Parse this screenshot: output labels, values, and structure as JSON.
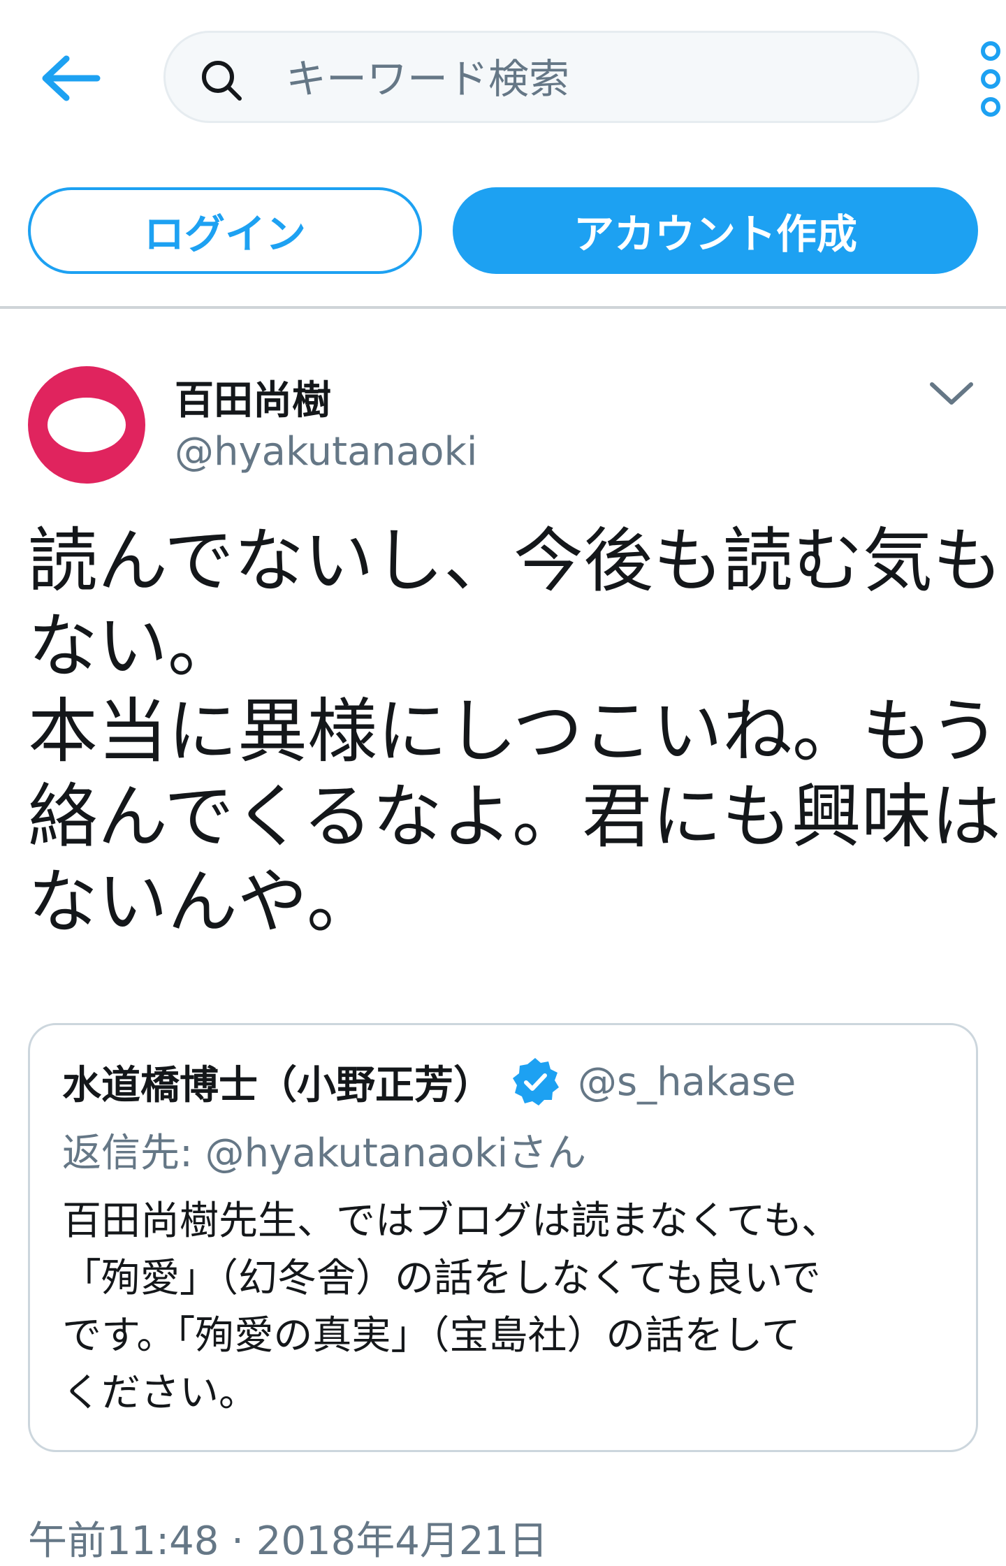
{
  "search": {
    "placeholder": "キーワード検索"
  },
  "auth": {
    "login_label": "ログイン",
    "signup_label": "アカウント作成"
  },
  "tweet": {
    "author_name": "百田尚樹",
    "author_handle": "@hyakutanaoki",
    "text_lines": [
      "読んでないし、今後も読む気も",
      "ない。",
      "本当に異様にしつこいね。もう",
      "絡んでくるなよ。君にも興味は",
      "ないんや。"
    ],
    "timestamp": "午前11:48 · 2018年4月21日"
  },
  "quoted": {
    "name": "水道橋博士（小野正芳）",
    "handle": "@s_hakase",
    "reply_to": "返信先: @hyakutanaokiさん",
    "text_lines": [
      "百田尚樹先生、ではブログは読まなくても、",
      "「殉愛」（幻冬舎）の話をしなくても良いで",
      "です。「殉愛の真実」（宝島社）の話をして",
      "ください。"
    ]
  },
  "colors": {
    "accent": "#1da1f2",
    "avatar_bg": "#e0245e",
    "secondary_text": "#657786"
  },
  "icons": [
    "back-arrow-icon",
    "search-icon",
    "more-vertical-icon",
    "chevron-down-icon",
    "verified-badge-icon",
    "default-avatar-egg-icon"
  ]
}
